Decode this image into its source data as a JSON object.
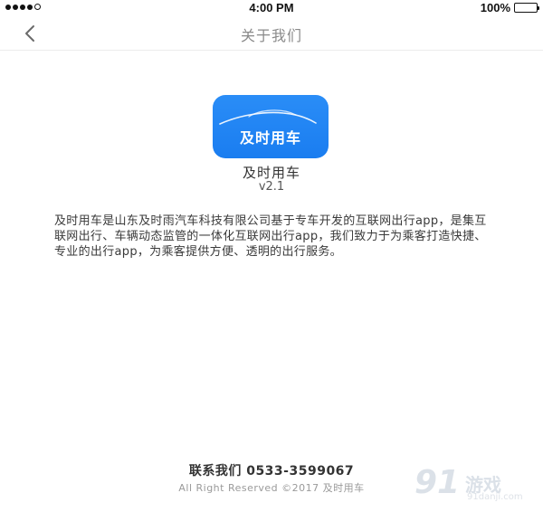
{
  "status_bar": {
    "time": "4:00 PM",
    "battery": "100%",
    "battery_level": 1.0,
    "signal_bars_filled": 4,
    "signal_bars_total": 5
  },
  "nav": {
    "title": "关于我们"
  },
  "app": {
    "logo_text": "及时用车",
    "name": "及时用车",
    "version": "v2.1",
    "brand_color": "#1f86f4"
  },
  "description": "及时用车是山东及时雨汽车科技有限公司基于专车开发的互联网出行app，是集互联网出行、车辆动态监管的一体化互联网出行app，我们致力于为乘客打造快捷、专业的出行app，为乘客提供方便、透明的出行服务。",
  "footer": {
    "contact": "联系我们 0533-3599067",
    "copyright": "All Right Reserved ©2017 及时用车"
  },
  "watermark": {
    "number": "91",
    "brand": "游戏",
    "site": "91danji.com"
  }
}
